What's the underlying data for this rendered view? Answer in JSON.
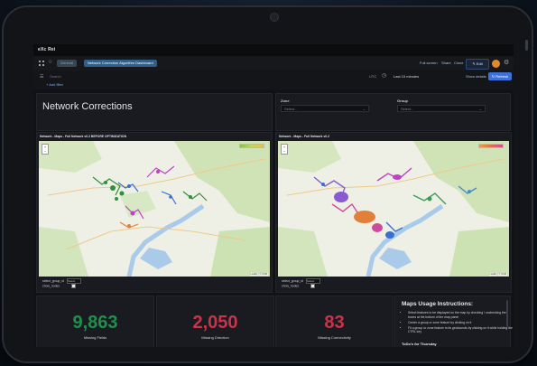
{
  "app": {
    "logo": "eXc Rei"
  },
  "breadcrumb": {
    "folder": "General",
    "dashboard": "Network Correction Algorithm Dashboard"
  },
  "topbar": {
    "links": [
      "Full screen",
      "Share",
      "Clone"
    ],
    "edit_label": "Edit"
  },
  "toolbar": {
    "search_placeholder": "Search",
    "tz": "UTC",
    "time_range": "Last 15 minutes",
    "show_details": "Show details",
    "refresh_label": "Refresh"
  },
  "filters": {
    "add_label": "+ Add filter"
  },
  "page": {
    "title": "Network Corrections"
  },
  "selectors": [
    {
      "label": "Zone",
      "placeholder": "Select..."
    },
    {
      "label": "Group",
      "placeholder": "Select..."
    }
  ],
  "maps": [
    {
      "title": "Network - Maps - Full Network v0.2 BEFORE OPTIMIZATION",
      "select_label": "select_group_id",
      "select_value": "Select",
      "show_nodes": "show_nodes"
    },
    {
      "title": "Network - Maps - Full Network v0.2",
      "select_label": "select_group_id",
      "select_value": "Select",
      "show_nodes": "show_nodes"
    }
  ],
  "stats": [
    {
      "value": "9,863",
      "label": "Missing Fields",
      "color": "#1f8f4e"
    },
    {
      "value": "2,050",
      "label": "Missing Direction",
      "color": "#c8344a"
    },
    {
      "value": "83",
      "label": "Missing Connectivity",
      "color": "#c8344a"
    }
  ],
  "instructions": {
    "title": "Maps Usage Instructions:",
    "items": [
      "Select features to be displayed on the map by checking / unchecking the boxes at the bottom of the map panel",
      "Center a group or zone feature by clicking on it",
      "Fit a group or zone feature to its geobounds by clicking on it while holding the CTRL key"
    ],
    "footer": "ToDo's for Thursday"
  },
  "colors": {
    "accent": "#3d71d9",
    "good": "#1f8f4e",
    "bad": "#c8344a"
  }
}
